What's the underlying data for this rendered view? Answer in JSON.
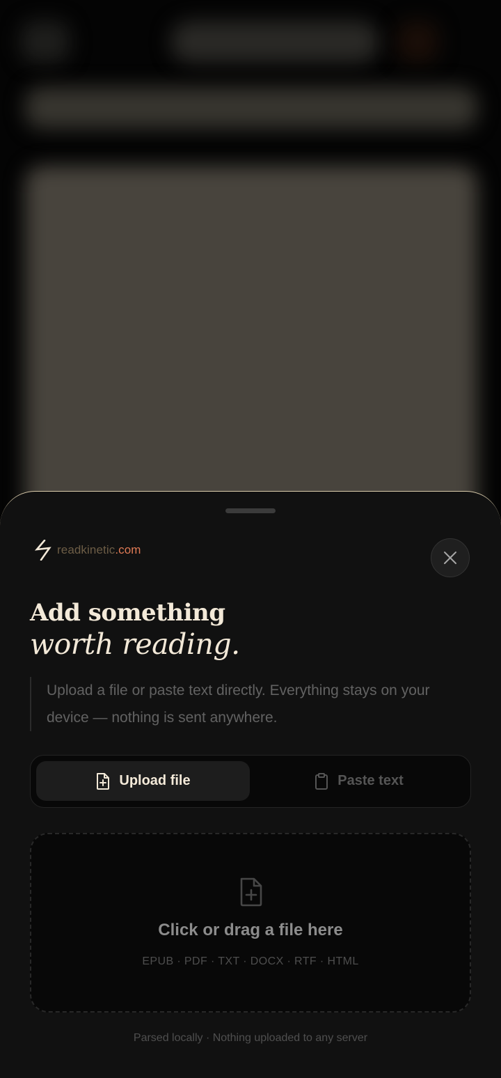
{
  "brand": {
    "name": "readkinetic",
    "tld": ".com"
  },
  "headline": {
    "line1": "Add something",
    "line2": "worth reading."
  },
  "description": "Upload a file or paste text directly. Everything stays on your device — nothing is sent anywhere.",
  "tabs": [
    {
      "label": "Upload file",
      "icon": "file-plus-icon",
      "active": true
    },
    {
      "label": "Paste text",
      "icon": "clipboard-icon",
      "active": false
    }
  ],
  "dropzone": {
    "title": "Click or drag a file here",
    "formats": "EPUB · PDF · TXT · DOCX · RTF · HTML",
    "icon": "file-plus-icon"
  },
  "footer": "Parsed locally · Nothing uploaded to any server",
  "colors": {
    "accent": "#e07a55",
    "cream": "#f3e9d8",
    "sheet_bg": "#111111",
    "sheet_border": "#d9cbab"
  }
}
